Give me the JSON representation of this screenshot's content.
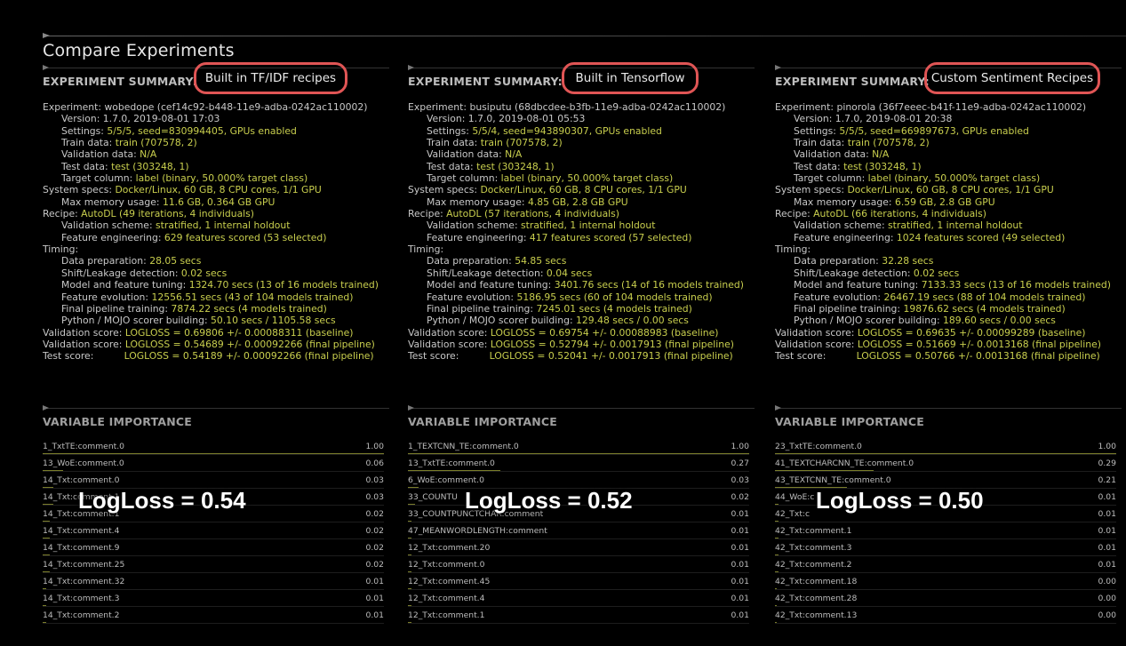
{
  "page_title": "Compare Experiments",
  "summary_heading": "EXPERIMENT SUMMARY:",
  "vi_heading": "VARIABLE IMPORTANCE",
  "colors": {
    "accent_value": "#c9cf4e",
    "highlight_border": "#e05555",
    "background": "#000000"
  },
  "experiments": [
    {
      "recipe_label": "Built in TF/IDF recipes",
      "lines": [
        {
          "k": "Experiment:",
          "v": "wobedope (cef14c92-b448-11e9-adba-0242ac110002)",
          "indent": false,
          "plain": true
        },
        {
          "k": "Version:",
          "v": "1.7.0, 2019-08-01 17:03",
          "indent": true,
          "plain": true
        },
        {
          "k": "Settings:",
          "v": "5/5/5, seed=830994405, GPUs enabled",
          "indent": true
        },
        {
          "k": "Train data:",
          "v": "train (707578, 2)",
          "indent": true
        },
        {
          "k": "Validation data:",
          "v": "N/A",
          "indent": true
        },
        {
          "k": "Test data:",
          "v": "test (303248, 1)",
          "indent": true
        },
        {
          "k": "Target column:",
          "v": "label (binary, 50.000% target class)",
          "indent": true
        },
        {
          "k": "System specs:",
          "v": "Docker/Linux, 60 GB, 8 CPU cores, 1/1 GPU",
          "indent": false
        },
        {
          "k": "Max memory usage:",
          "v": "11.6 GB, 0.364 GB GPU",
          "indent": true
        },
        {
          "k": "Recipe:",
          "v": "AutoDL (49 iterations, 4 individuals)",
          "indent": false
        },
        {
          "k": "Validation scheme:",
          "v": "stratified, 1 internal holdout",
          "indent": true
        },
        {
          "k": "Feature engineering:",
          "v": "629 features scored (53 selected)",
          "indent": true
        },
        {
          "k": "Timing:",
          "v": "",
          "indent": false
        },
        {
          "k": "Data preparation:",
          "v": "28.05 secs",
          "indent": true
        },
        {
          "k": "Shift/Leakage detection:",
          "v": "0.02 secs",
          "indent": true
        },
        {
          "k": "Model and feature tuning:",
          "v": "1324.70 secs (13 of 16 models trained)",
          "indent": true
        },
        {
          "k": "Feature evolution:",
          "v": "12556.51 secs (43 of 104 models trained)",
          "indent": true
        },
        {
          "k": "Final pipeline training:",
          "v": "7874.22 secs (4 models trained)",
          "indent": true
        },
        {
          "k": "Python / MOJO scorer building:",
          "v": "50.10 secs / 1105.58 secs",
          "indent": true
        },
        {
          "k": "Validation score:",
          "v": "LOGLOSS = 0.69806 +/- 0.00088311 (baseline)",
          "indent": false
        },
        {
          "k": "Validation score:",
          "v": "LOGLOSS = 0.54689 +/- 0.00092266 (final pipeline)",
          "indent": false
        },
        {
          "k": "Test score:",
          "v": "LOGLOSS = 0.54189 +/- 0.00092266 (final pipeline)",
          "indent": false,
          "wide": true
        }
      ],
      "variables": [
        {
          "name": "1_TxtTE:comment.0",
          "value": "1.00",
          "frac": 1.0
        },
        {
          "name": "13_WoE:comment.0",
          "value": "0.06",
          "frac": 0.06
        },
        {
          "name": "14_Txt:comment.0",
          "value": "0.03",
          "frac": 0.03
        },
        {
          "name": "14_Txt:comment.1",
          "value": "0.03",
          "frac": 0.03
        },
        {
          "name": "14_Txt:comment.1",
          "value": "0.02",
          "frac": 0.02
        },
        {
          "name": "14_Txt:comment.4",
          "value": "0.02",
          "frac": 0.02
        },
        {
          "name": "14_Txt:comment.9",
          "value": "0.02",
          "frac": 0.02
        },
        {
          "name": "14_Txt:comment.25",
          "value": "0.02",
          "frac": 0.02
        },
        {
          "name": "14_Txt:comment.32",
          "value": "0.01",
          "frac": 0.01
        },
        {
          "name": "14_Txt:comment.3",
          "value": "0.01",
          "frac": 0.01
        },
        {
          "name": "14_Txt:comment.2",
          "value": "0.01",
          "frac": 0.01
        }
      ],
      "logloss_caption": "LogLoss = 0.54"
    },
    {
      "recipe_label": "Built in Tensorflow",
      "lines": [
        {
          "k": "Experiment:",
          "v": "busiputu (68dbcdee-b3fb-11e9-adba-0242ac110002)",
          "indent": false,
          "plain": true
        },
        {
          "k": "Version:",
          "v": "1.7.0, 2019-08-01 05:53",
          "indent": true,
          "plain": true
        },
        {
          "k": "Settings:",
          "v": "5/5/4, seed=943890307, GPUs enabled",
          "indent": true
        },
        {
          "k": "Train data:",
          "v": "train (707578, 2)",
          "indent": true
        },
        {
          "k": "Validation data:",
          "v": "N/A",
          "indent": true
        },
        {
          "k": "Test data:",
          "v": "test (303248, 1)",
          "indent": true
        },
        {
          "k": "Target column:",
          "v": "label (binary, 50.000% target class)",
          "indent": true
        },
        {
          "k": "System specs:",
          "v": "Docker/Linux, 60 GB, 8 CPU cores, 1/1 GPU",
          "indent": false
        },
        {
          "k": "Max memory usage:",
          "v": "4.85 GB, 2.8 GB GPU",
          "indent": true
        },
        {
          "k": "Recipe:",
          "v": "AutoDL (57 iterations, 4 individuals)",
          "indent": false
        },
        {
          "k": "Validation scheme:",
          "v": "stratified, 1 internal holdout",
          "indent": true
        },
        {
          "k": "Feature engineering:",
          "v": "417 features scored (57 selected)",
          "indent": true
        },
        {
          "k": "Timing:",
          "v": "",
          "indent": false
        },
        {
          "k": "Data preparation:",
          "v": "54.85 secs",
          "indent": true
        },
        {
          "k": "Shift/Leakage detection:",
          "v": "0.04 secs",
          "indent": true
        },
        {
          "k": "Model and feature tuning:",
          "v": "3401.76 secs (14 of 16 models trained)",
          "indent": true
        },
        {
          "k": "Feature evolution:",
          "v": "5186.95 secs (60 of 104 models trained)",
          "indent": true
        },
        {
          "k": "Final pipeline training:",
          "v": "7245.01 secs (4 models trained)",
          "indent": true
        },
        {
          "k": "Python / MOJO scorer building:",
          "v": "129.48 secs / 0.00 secs",
          "indent": true
        },
        {
          "k": "Validation score:",
          "v": "LOGLOSS = 0.69754 +/- 0.00088983 (baseline)",
          "indent": false
        },
        {
          "k": "Validation score:",
          "v": "LOGLOSS = 0.52794 +/- 0.0017913 (final pipeline)",
          "indent": false
        },
        {
          "k": "Test score:",
          "v": "LOGLOSS = 0.52041 +/- 0.0017913 (final pipeline)",
          "indent": false,
          "wide": true
        }
      ],
      "variables": [
        {
          "name": "1_TEXTCNN_TE:comment.0",
          "value": "1.00",
          "frac": 1.0
        },
        {
          "name": "13_TxtTE:comment.0",
          "value": "0.27",
          "frac": 0.27
        },
        {
          "name": "6_WoE:comment.0",
          "value": "0.03",
          "frac": 0.03
        },
        {
          "name": "33_COUNTU",
          "value": "0.02",
          "frac": 0.02
        },
        {
          "name": "33_COUNTPUNCTCHAR:comment",
          "value": "0.01",
          "frac": 0.01
        },
        {
          "name": "47_MEANWORDLENGTH:comment",
          "value": "0.01",
          "frac": 0.01
        },
        {
          "name": "12_Txt:comment.20",
          "value": "0.01",
          "frac": 0.01
        },
        {
          "name": "12_Txt:comment.0",
          "value": "0.01",
          "frac": 0.01
        },
        {
          "name": "12_Txt:comment.45",
          "value": "0.01",
          "frac": 0.01
        },
        {
          "name": "12_Txt:comment.4",
          "value": "0.01",
          "frac": 0.01
        },
        {
          "name": "12_Txt:comment.1",
          "value": "0.01",
          "frac": 0.01
        }
      ],
      "logloss_caption": "LogLoss = 0.52"
    },
    {
      "recipe_label": "Custom Sentiment Recipes",
      "lines": [
        {
          "k": "Experiment:",
          "v": "pinorola (36f7eeec-b41f-11e9-adba-0242ac110002)",
          "indent": false,
          "plain": true
        },
        {
          "k": "Version:",
          "v": "1.7.0, 2019-08-01 20:38",
          "indent": true,
          "plain": true
        },
        {
          "k": "Settings:",
          "v": "5/5/5, seed=669897673, GPUs enabled",
          "indent": true
        },
        {
          "k": "Train data:",
          "v": "train (707578, 2)",
          "indent": true
        },
        {
          "k": "Validation data:",
          "v": "N/A",
          "indent": true
        },
        {
          "k": "Test data:",
          "v": "test (303248, 1)",
          "indent": true
        },
        {
          "k": "Target column:",
          "v": "label (binary, 50.000% target class)",
          "indent": true
        },
        {
          "k": "System specs:",
          "v": "Docker/Linux, 60 GB, 8 CPU cores, 1/1 GPU",
          "indent": false
        },
        {
          "k": "Max memory usage:",
          "v": "6.59 GB, 2.8 GB GPU",
          "indent": true
        },
        {
          "k": "Recipe:",
          "v": "AutoDL (66 iterations, 4 individuals)",
          "indent": false
        },
        {
          "k": "Validation scheme:",
          "v": "stratified, 1 internal holdout",
          "indent": true
        },
        {
          "k": "Feature engineering:",
          "v": "1024 features scored (49 selected)",
          "indent": true
        },
        {
          "k": "Timing:",
          "v": "",
          "indent": false
        },
        {
          "k": "Data preparation:",
          "v": "32.28 secs",
          "indent": true
        },
        {
          "k": "Shift/Leakage detection:",
          "v": "0.02 secs",
          "indent": true
        },
        {
          "k": "Model and feature tuning:",
          "v": "7133.33 secs (13 of 16 models trained)",
          "indent": true
        },
        {
          "k": "Feature evolution:",
          "v": "26467.19 secs (88 of 104 models trained)",
          "indent": true
        },
        {
          "k": "Final pipeline training:",
          "v": "19876.62 secs (4 models trained)",
          "indent": true
        },
        {
          "k": "Python / MOJO scorer building:",
          "v": "189.60 secs / 0.00 secs",
          "indent": true
        },
        {
          "k": "Validation score:",
          "v": "LOGLOSS = 0.69635 +/- 0.00099289 (baseline)",
          "indent": false
        },
        {
          "k": "Validation score:",
          "v": "LOGLOSS = 0.51669 +/- 0.0013168 (final pipeline)",
          "indent": false
        },
        {
          "k": "Test score:",
          "v": "LOGLOSS = 0.50766 +/- 0.0013168 (final pipeline)",
          "indent": false,
          "wide": true
        }
      ],
      "variables": [
        {
          "name": "23_TxtTE:comment.0",
          "value": "1.00",
          "frac": 1.0
        },
        {
          "name": "41_TEXTCHARCNN_TE:comment.0",
          "value": "0.29",
          "frac": 0.29
        },
        {
          "name": "43_TEXTCNN_TE:comment.0",
          "value": "0.21",
          "frac": 0.21
        },
        {
          "name": "44_WoE:c",
          "value": "0.01",
          "frac": 0.01
        },
        {
          "name": "42_Txt:c",
          "value": "0.01",
          "frac": 0.01
        },
        {
          "name": "42_Txt:comment.1",
          "value": "0.01",
          "frac": 0.01
        },
        {
          "name": "42_Txt:comment.3",
          "value": "0.01",
          "frac": 0.01
        },
        {
          "name": "42_Txt:comment.2",
          "value": "0.01",
          "frac": 0.01
        },
        {
          "name": "42_Txt:comment.18",
          "value": "0.00",
          "frac": 0.0
        },
        {
          "name": "42_Txt:comment.28",
          "value": "0.00",
          "frac": 0.0
        },
        {
          "name": "42_Txt:comment.13",
          "value": "0.00",
          "frac": 0.0
        }
      ],
      "logloss_caption": "LogLoss = 0.50"
    }
  ]
}
